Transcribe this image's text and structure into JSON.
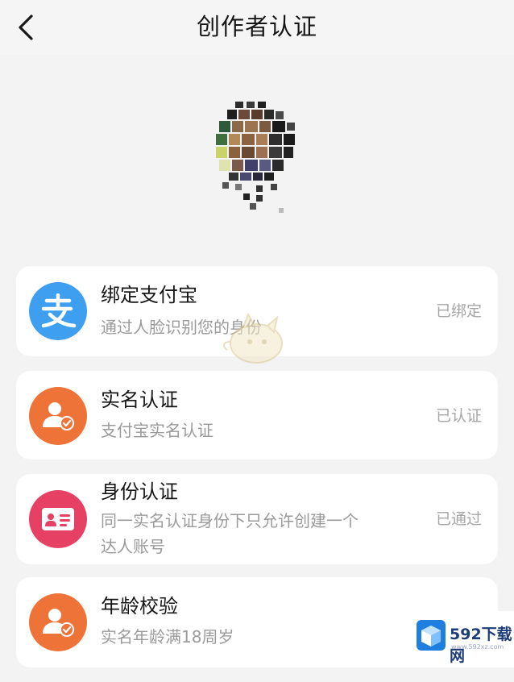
{
  "header": {
    "back_icon": "chevron-left-icon",
    "title": "创作者认证"
  },
  "items": [
    {
      "title": "绑定支付宝",
      "desc": "通过人脸识别您的身份",
      "status": "已绑定",
      "icon": "alipay-icon",
      "icon_color": "#3e9ff0"
    },
    {
      "title": "实名认证",
      "desc": "支付宝实名认证",
      "status": "已认证",
      "icon": "user-verified-icon",
      "icon_color": "#ee7339"
    },
    {
      "title": "身份认证",
      "desc": "同一实名认证身份下只允许创建一个",
      "desc2": "达人账号",
      "status": "已通过",
      "icon": "id-card-icon",
      "icon_color": "#e64064"
    },
    {
      "title": "年龄校验",
      "desc": "实名年龄满18周岁",
      "status": "",
      "icon": "user-verified-icon",
      "icon_color": "#ee7339"
    }
  ],
  "watermark": {
    "brand": "592下载网",
    "url": "www.592xz.com"
  }
}
